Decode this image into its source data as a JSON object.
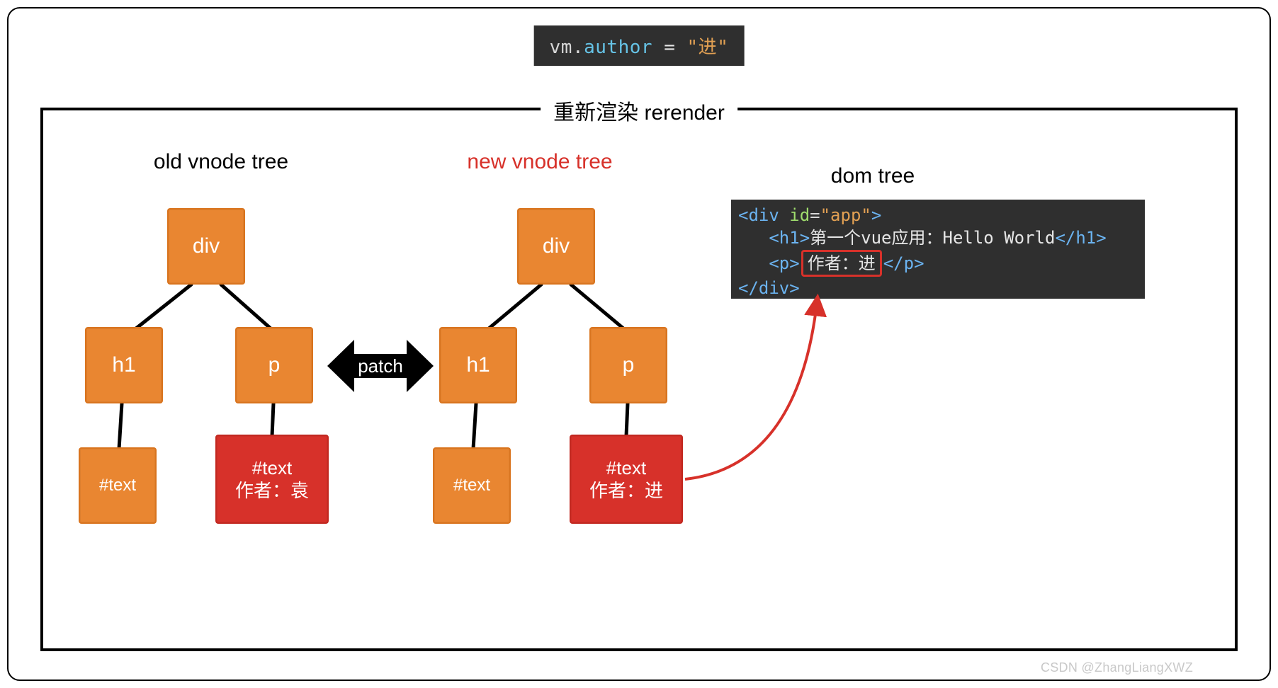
{
  "codeLine": {
    "var": "vm",
    "dot": ".",
    "prop": "author",
    "eq": " = ",
    "quote": "\"",
    "value": "进"
  },
  "frame": {
    "legend": "重新渲染 rerender"
  },
  "sections": {
    "old": "old vnode tree",
    "new": "new vnode tree",
    "dom": "dom tree"
  },
  "nodes": {
    "div": "div",
    "h1": "h1",
    "p": "p",
    "text": "#text",
    "oldLeaf": "#text\n作者：袁",
    "newLeaf": "#text\n作者：进"
  },
  "patch": "patch",
  "dom": {
    "l1_open": "<div",
    "l1_attr": " id",
    "l1_eq": "=",
    "l1_val": "\"app\"",
    "l1_close": ">",
    "l2_open": "<h1>",
    "l2_text": "第一个vue应用：Hello World",
    "l2_close": "</h1>",
    "l3_open": "<p>",
    "l3_text": "作者：进",
    "l3_close": "</p>",
    "l4": "</div>"
  },
  "watermark": "CSDN @ZhangLiangXWZ"
}
